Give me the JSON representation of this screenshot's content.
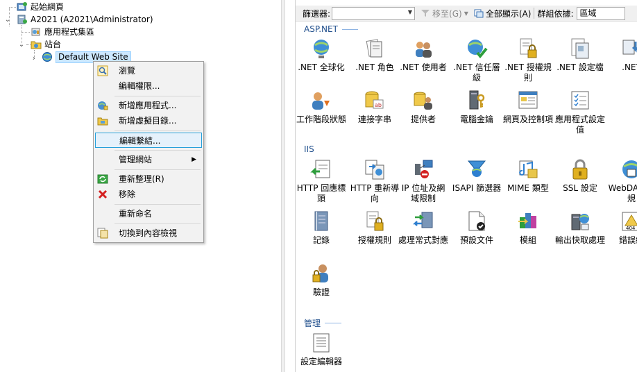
{
  "tree": {
    "start_page": "起始網頁",
    "server": "A2021 (A2021\\Administrator)",
    "app_pools": "應用程式集區",
    "sites": "站台",
    "default_site": "Default Web Site"
  },
  "context_menu": {
    "items": [
      {
        "label": "瀏覽",
        "icon": "browse-icon"
      },
      {
        "label": "編輯權限...",
        "icon": ""
      },
      {
        "label": "新增應用程式...",
        "icon": "add-application-icon"
      },
      {
        "label": "新增虛擬目錄...",
        "icon": "add-virtual-directory-icon"
      },
      {
        "label": "編輯繫結...",
        "icon": ""
      },
      {
        "label": "管理網站",
        "icon": ""
      },
      {
        "label": "重新整理(R)",
        "icon": "refresh-icon"
      },
      {
        "label": "移除",
        "icon": "remove-icon"
      },
      {
        "label": "重新命名",
        "icon": ""
      },
      {
        "label": "切換到內容檢視",
        "icon": "content-view-icon"
      }
    ]
  },
  "toolbar": {
    "filter_label": "篩選器:",
    "go_label": "移至(G)",
    "show_all_label": "全部顯示(A)",
    "group_by_label": "群組依據:",
    "group_by_value": "區域"
  },
  "sections": {
    "aspnet": "ASP.NET",
    "iis": "IIS",
    "management": "管理"
  },
  "features": {
    "aspnet": [
      ".NET 全球化",
      ".NET 角色",
      ".NET 使用者",
      ".NET 信任層級",
      ".NET 授權規則",
      ".NET 設定檔",
      ".NET",
      "工作階段狀態",
      "連接字串",
      "提供者",
      "電腦金鑰",
      "網頁及控制項",
      "應用程式設定值"
    ],
    "iis": [
      "HTTP 回應標頭",
      "HTTP 重新導向",
      "IP 位址及網域限制",
      "ISAPI 篩選器",
      "MIME 類型",
      "SSL 設定",
      "WebDAV 寫規",
      "記錄",
      "授權規則",
      "處理常式對應",
      "預設文件",
      "模組",
      "輸出快取處理",
      "錯誤網",
      "驗證"
    ],
    "management": [
      "設定編輯器"
    ]
  },
  "colors": {
    "section_header": "#1f4e8c",
    "selection_bg": "#cce8ff",
    "menu_highlight": "#e5f1fb"
  }
}
